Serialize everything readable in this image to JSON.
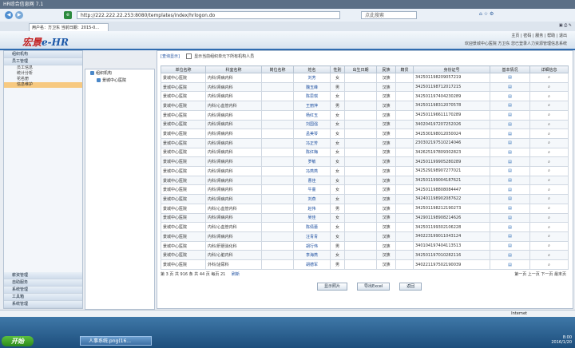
{
  "window": {
    "title": "HR综合信息网 7.1"
  },
  "browser": {
    "url": "http://222.222.22.253:8080/templates/index/hrlogon.do",
    "search_placeholder": "点此搜索",
    "tab_label": "用户名：方卫东  当前日期：2015-0..."
  },
  "app": {
    "logo_main": "宏景",
    "logo_e": "e",
    "logo_hr": "-HR",
    "header_links": [
      "主页",
      "密码",
      "服务",
      "帮助",
      "退出"
    ],
    "welcome": "欢迎景城中心医院 方卫东 您已登录人力资源管理信息系统"
  },
  "sidebar": {
    "items": [
      {
        "label": "组织机构"
      },
      {
        "label": "员工管理"
      }
    ],
    "subitems": [
      "员工信息",
      "统计分析",
      "花名册",
      "信息维护"
    ],
    "selected_index": 3,
    "bottom_items": [
      "薪资管理",
      "自助服务",
      "系统管理",
      "工具箱",
      "系统管理"
    ]
  },
  "tree": {
    "root": "组织机构",
    "child": "景城中心医院"
  },
  "filter": {
    "query_btn": "[查询显示]",
    "checkbox_label": "显示当前组织单元下所有机构人员"
  },
  "table": {
    "columns": [
      "单位名称",
      "科室名称",
      "岗位名称",
      "姓名",
      "性别",
      "出生日期",
      "民族",
      "籍贯",
      "身份证号",
      "基本情况",
      "详细信息"
    ],
    "rows": [
      [
        "景城中心医院",
        "内科/肾病内科",
        "",
        "刘芳",
        "女",
        "",
        "汉族",
        "",
        "342501198209057219",
        "",
        ""
      ],
      [
        "景城中心医院",
        "内科/肾病内科",
        "",
        "魏玉峰",
        "男",
        "",
        "汉族",
        "",
        "342501198712017215",
        "",
        ""
      ],
      [
        "景城中心医院",
        "内科/肾病内科",
        "",
        "陈思琪",
        "女",
        "",
        "汉族",
        "",
        "342501197404230289",
        "",
        ""
      ],
      [
        "景城中心医院",
        "内科/心血管内科",
        "",
        "王丽萍",
        "男",
        "",
        "汉族",
        "",
        "342501198312070578",
        "",
        ""
      ],
      [
        "景城中心医院",
        "内科/肾病内科",
        "",
        "杨红玉",
        "女",
        "",
        "汉族",
        "",
        "342501196611170289",
        "",
        ""
      ],
      [
        "景城中心医院",
        "内科/肾病内科",
        "",
        "刘国强",
        "女",
        "",
        "汉族",
        "",
        "340204197207252026",
        "",
        ""
      ],
      [
        "景城中心医院",
        "内科/肾病内科",
        "",
        "孟美琴",
        "女",
        "",
        "汉族",
        "",
        "342530198012050024",
        "",
        ""
      ],
      [
        "景城中心医院",
        "内科/肾病内科",
        "",
        "冯正芳",
        "女",
        "",
        "汉族",
        "",
        "230302197510214046",
        "",
        ""
      ],
      [
        "景城中心医院",
        "内科/肾病内科",
        "",
        "陈红梅",
        "女",
        "",
        "汉族",
        "",
        "342625197809302823",
        "",
        ""
      ],
      [
        "景城中心医院",
        "内科/肾病内科",
        "",
        "罗敏",
        "女",
        "",
        "汉族",
        "",
        "342501199905280289",
        "",
        ""
      ],
      [
        "景城中心医院",
        "内科/肾病内科",
        "",
        "冯燕燕",
        "女",
        "",
        "汉族",
        "",
        "342529198907277021",
        "",
        ""
      ],
      [
        "景城中心医院",
        "内科/肾病内科",
        "",
        "曹佳",
        "女",
        "",
        "汉族",
        "",
        "342501199004187621",
        "",
        ""
      ],
      [
        "景城中心医院",
        "内科/肾病内科",
        "",
        "牛童",
        "女",
        "",
        "汉族",
        "",
        "342501198808084447",
        "",
        ""
      ],
      [
        "景城中心医院",
        "内科/肾病内科",
        "",
        "刘燕",
        "女",
        "",
        "汉族",
        "",
        "342401198902087622",
        "",
        ""
      ],
      [
        "景城中心医院",
        "内科/心血管内科",
        "",
        "赵伟",
        "男",
        "",
        "汉族",
        "",
        "342501198212190273",
        "",
        ""
      ],
      [
        "景城中心医院",
        "内科/肾病内科",
        "",
        "吴佳",
        "女",
        "",
        "汉族",
        "",
        "342901198908214626",
        "",
        ""
      ],
      [
        "景城中心医院",
        "内科/心血管内科",
        "",
        "陈倩蕾",
        "女",
        "",
        "汉族",
        "",
        "342501199302106228",
        "",
        ""
      ],
      [
        "景城中心医院",
        "内科/肾病内科",
        "",
        "汪青青",
        "女",
        "",
        "汉族",
        "",
        "340223199011043124",
        "",
        ""
      ],
      [
        "景城中心医院",
        "内科/肝胆消化科",
        "",
        "胡行伟",
        "男",
        "",
        "汉族",
        "",
        "340104197404113513",
        "",
        ""
      ],
      [
        "景城中心医院",
        "内科/心脏内科",
        "",
        "李海燕",
        "女",
        "",
        "汉族",
        "",
        "342501197010282116",
        "",
        ""
      ],
      [
        "景城中心医院",
        "外科/泌尿科",
        "",
        "胡德军",
        "男",
        "",
        "汉族",
        "",
        "340221197502190039",
        "",
        ""
      ]
    ]
  },
  "pager": {
    "text": "第 3 页  共 916 条  共 44 页  每页 21",
    "go": "刷新",
    "nav": "第一页 上一页 下一页 最末页"
  },
  "buttons": [
    "显示照片",
    "导出Excel",
    "返回"
  ],
  "status": {
    "left": "",
    "right": "Internet"
  },
  "taskbar": {
    "start": "开始",
    "task_label": "人事系统.png(16...",
    "time": "8:00",
    "date": "2016/1/20"
  }
}
